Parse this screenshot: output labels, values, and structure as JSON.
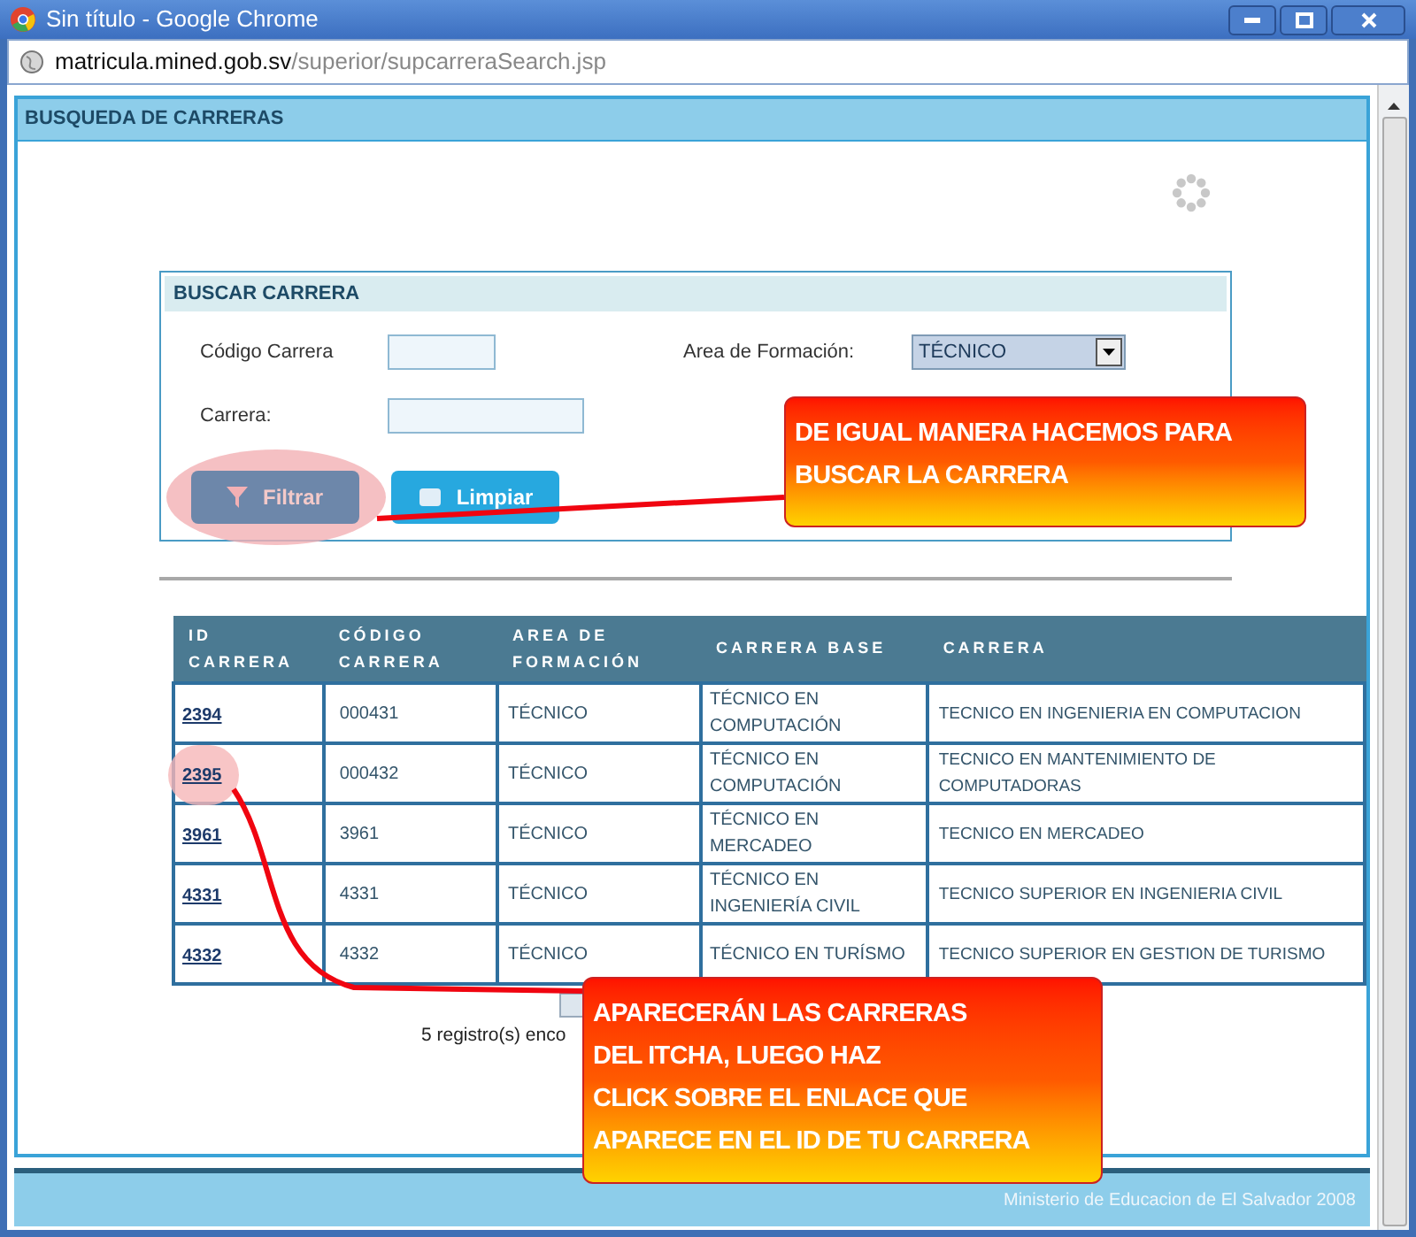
{
  "window": {
    "title": "Sin título - Google Chrome"
  },
  "address_bar": {
    "domain": "matricula.mined.gob.sv",
    "path": "/superior/supcarreraSearch.jsp"
  },
  "page_header": "BUSQUEDA DE CARRERAS",
  "search_panel": {
    "title": "BUSCAR CARRERA",
    "code_field": {
      "label": "Código Carrera"
    },
    "name_field": {
      "label": "Carrera:"
    },
    "area": {
      "label": "Area de Formación:",
      "value": "TÉCNICO"
    },
    "buttons": [
      {
        "label": "Filtrar",
        "kind": "filter",
        "highlighted": true
      },
      {
        "label": "Limpiar",
        "kind": "clear",
        "highlighted": false
      }
    ]
  },
  "table": {
    "columns": [
      "ID CARRERA",
      "CÓDIGO CARRERA",
      "AREA DE FORMACIÓN",
      "CARRERA BASE",
      "CARRERA"
    ],
    "rows": [
      {
        "id": "2394",
        "code": "000431",
        "area": "TÉCNICO",
        "base": "TÉCNICO EN COMPUTACIÓN",
        "name": "TECNICO EN INGENIERIA EN COMPUTACION",
        "highlighted": false
      },
      {
        "id": "2395",
        "code": "000432",
        "area": "TÉCNICO",
        "base": "TÉCNICO EN COMPUTACIÓN",
        "name": "TECNICO EN MANTENIMIENTO DE COMPUTADORAS",
        "highlighted": true
      },
      {
        "id": "3961",
        "code": "3961",
        "area": "TÉCNICO",
        "base": "TÉCNICO EN MERCADEO",
        "name": "TECNICO EN MERCADEO",
        "highlighted": false
      },
      {
        "id": "4331",
        "code": "4331",
        "area": "TÉCNICO",
        "base": "TÉCNICO EN INGENIERÍA CIVIL",
        "name": "TECNICO SUPERIOR EN INGENIERIA CIVIL",
        "highlighted": false
      },
      {
        "id": "4332",
        "code": "4332",
        "area": "TÉCNICO",
        "base": "TÉCNICO EN TURÍSMO",
        "name": "TECNICO SUPERIOR EN GESTION DE TURISMO",
        "highlighted": false
      }
    ]
  },
  "record_count": "5 registro(s) enco",
  "footer": "Ministerio de Educacion de El Salvador 2008",
  "callouts": [
    {
      "lines": [
        "DE IGUAL MANERA HACEMOS PARA",
        "BUSCAR LA CARRERA"
      ]
    },
    {
      "lines": [
        "APARECERÁN LAS CARRERAS",
        "DEL ITCHA, LUEGO HAZ",
        "CLICK SOBRE EL ENLACE QUE",
        "APARECE EN EL ID DE TU CARRERA"
      ]
    }
  ]
}
